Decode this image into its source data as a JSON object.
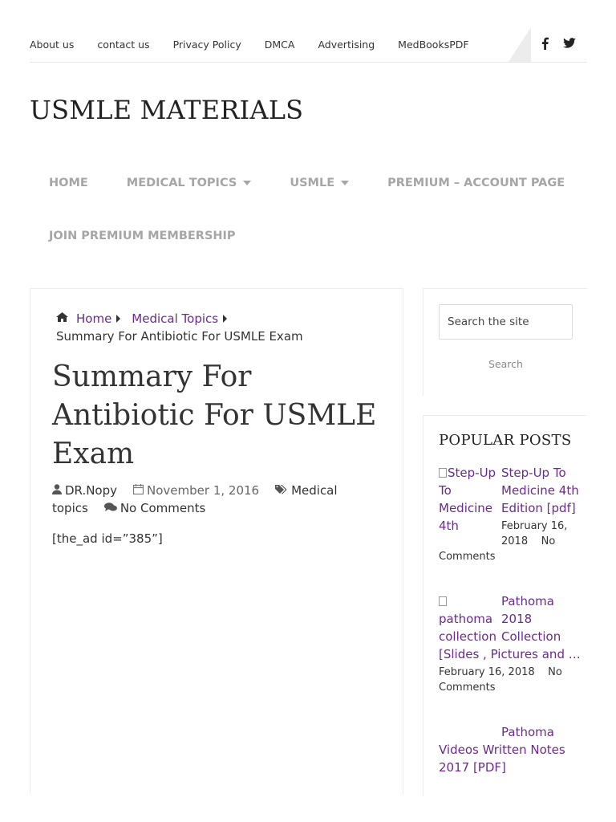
{
  "topnav": {
    "items": [
      "About us",
      "contact us",
      "Privacy Policy",
      "DMCA",
      "Advertising",
      "MedBooksPDF"
    ]
  },
  "social": {
    "facebook": "f",
    "twitter": "ὂ6"
  },
  "site": {
    "title": "USMLE MATERIALS"
  },
  "mainnav": {
    "items": [
      {
        "label": "HOME"
      },
      {
        "label": "MEDICAL TOPICS"
      },
      {
        "label": "USMLE"
      },
      {
        "label": "PREMIUM – ACCOUNT PAGE"
      },
      {
        "label": "JOIN PREMIUM MEMBERSHIP"
      }
    ]
  },
  "breadcrumb": {
    "home": "Home",
    "category": "Medical Topics",
    "current": "Summary For Antibiotic For USMLE Exam"
  },
  "post": {
    "title": "Summary For Antibiotic For USMLE Exam",
    "author": "DR.Nopy",
    "date": "November 1, 2016",
    "category": "Medical topics",
    "comments": "No Comments",
    "body": "[the_ad id=”385”]"
  },
  "search": {
    "placeholder": "Search the site",
    "button": "Search"
  },
  "popular": {
    "title": "POPULAR POSTS",
    "posts": [
      {
        "img_alt": "Step-Up To Medicine 4th",
        "title": "Step-Up To Medicine 4th Edition [pdf]",
        "date": "February 16, 2018",
        "comments": "No Comments"
      },
      {
        "img_alt": "pathoma collection",
        "title": "Pathoma 2018 Collection [Slides , Pictures and …",
        "date": "February 16, 2018",
        "comments": "No Comments"
      },
      {
        "img_alt": "",
        "title": "Pathoma Videos Written Notes 2017 [PDF]"
      }
    ]
  },
  "colors": {
    "link": "#6b2a8f",
    "nav_gray": "#a6a6a6",
    "text": "#333333"
  }
}
